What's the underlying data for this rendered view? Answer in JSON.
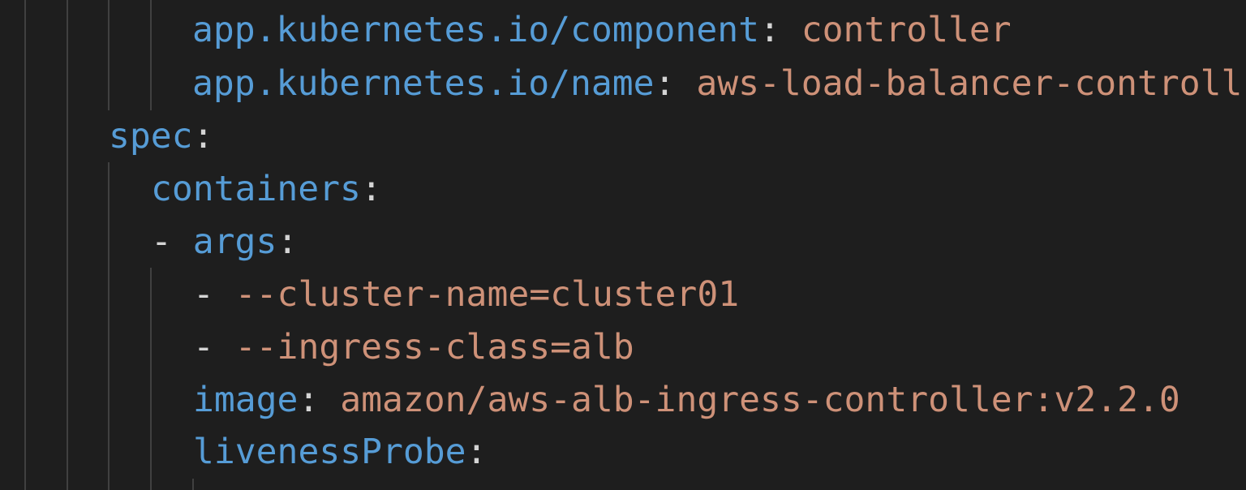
{
  "editor": {
    "lines": [
      {
        "key": "app.kubernetes.io/component",
        "sep": ":",
        "value": " controller"
      },
      {
        "key": "app.kubernetes.io/name",
        "sep": ":",
        "value": " aws-load-balancer-controll"
      },
      {
        "key": "spec",
        "sep": ":",
        "value": ""
      },
      {
        "key": "containers",
        "sep": ":",
        "value": ""
      },
      {
        "dash": "- ",
        "key": "args",
        "sep": ":",
        "value": ""
      },
      {
        "dash": "- ",
        "value": "--cluster-name=cluster01"
      },
      {
        "dash": "- ",
        "value": "--ingress-class=alb"
      },
      {
        "key": "image",
        "sep": ":",
        "value": " amazon/aws-alb-ingress-controller:v2.2.0"
      },
      {
        "key": "livenessProbe",
        "sep": ":",
        "value": ""
      }
    ],
    "colors": {
      "background": "#1e1e1e",
      "key": "#569cd6",
      "value": "#ce9178",
      "punctuation": "#d4d4d4",
      "indent_guide": "#404040"
    }
  }
}
